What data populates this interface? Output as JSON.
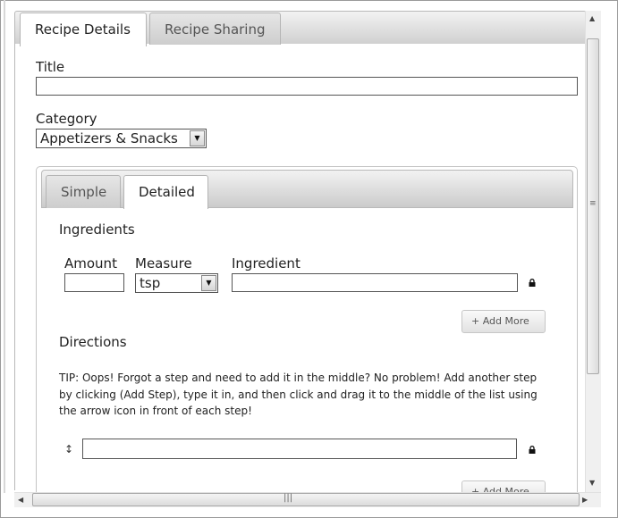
{
  "outer_tabs": [
    {
      "label": "Recipe Details",
      "active": true
    },
    {
      "label": "Recipe Sharing",
      "active": false
    }
  ],
  "title_field": {
    "label": "Title",
    "value": ""
  },
  "category_field": {
    "label": "Category",
    "selected": "Appetizers & Snacks"
  },
  "inner_tabs": [
    {
      "label": "Simple",
      "active": false
    },
    {
      "label": "Detailed",
      "active": true
    }
  ],
  "ingredients": {
    "heading": "Ingredients",
    "columns": {
      "amount": "Amount",
      "measure": "Measure",
      "ingredient": "Ingredient"
    },
    "row": {
      "amount": "",
      "measure": "tsp",
      "ingredient": ""
    },
    "add_more_label": "+ Add More"
  },
  "directions": {
    "heading": "Directions",
    "tip": "TIP: Oops! Forgot a step and need to add it in the middle? No problem! Add another step by clicking (Add Step), type it in, and then click and drag it to the middle of the list using the arrow icon in front of each step!",
    "step_value": "",
    "add_more_label": "+ Add More"
  },
  "icons": {
    "lock": "lock-icon",
    "drag": "drag-handle-icon",
    "dropdown": "chevron-down-icon"
  },
  "colors": {
    "tab_gradient_top": "#f2f2f2",
    "tab_gradient_bottom": "#cbcbcb",
    "border": "#b9b9b9"
  }
}
